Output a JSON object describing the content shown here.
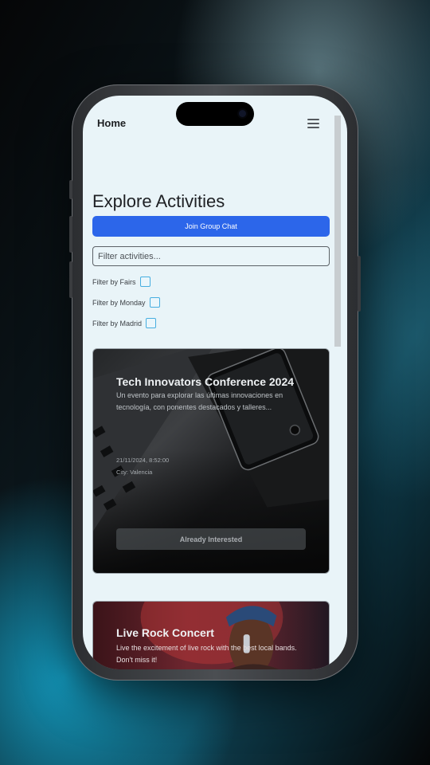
{
  "nav": {
    "title": "Home",
    "menu_icon": "hamburger-menu-icon"
  },
  "page": {
    "heading": "Explore Activities"
  },
  "actions": {
    "join_chat_label": "Join Group Chat"
  },
  "search": {
    "placeholder": "Filter activities..."
  },
  "filters": [
    {
      "label": "Filter by Fairs",
      "checked": false
    },
    {
      "label": "Filter by Monday",
      "checked": false
    },
    {
      "label": "Filter by Madrid",
      "checked": false
    }
  ],
  "activities": [
    {
      "title": "Tech Innovators Conference 2024",
      "description": "Un evento para explorar las últimas innovaciones en tecnología, con ponentes destacados y talleres...",
      "datetime": "21/11/2024, 8:52:00",
      "city": "City: Valencia",
      "button_label": "Already Interested",
      "image": "laptop-and-phone-photo"
    },
    {
      "title": "Live Rock Concert",
      "description": "Live the excitement of live rock with the best local bands. Don't miss it!",
      "image": "singer-with-microphone-photo"
    }
  ],
  "colors": {
    "screen_bg": "#e9f4f8",
    "primary": "#2c66ea",
    "checkbox_border": "#47aee0"
  }
}
